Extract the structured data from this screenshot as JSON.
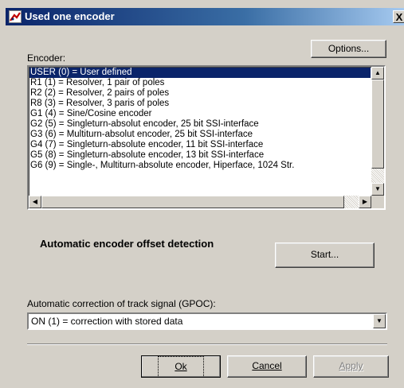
{
  "window": {
    "title": "Used one encoder",
    "close_label": "X"
  },
  "options_button": "Options...",
  "encoder": {
    "label": "Encoder:",
    "items": [
      "USER (0) = User defined",
      "R1 (1) = Resolver, 1 pair of poles",
      "R2 (2) = Resolver, 2 pairs of poles",
      "R8 (3) = Resolver, 3 paris of poles",
      "G1 (4) = Sine/Cosine encoder",
      "G2 (5) = Singleturn-absolut encoder, 25 bit SSI-interface",
      "G3 (6) = Multiturn-absolut encoder, 25 bit SSI-interface",
      "G4 (7) = Singleturn-absolute encoder, 11 bit SSI-interface",
      "G5 (8) = Singleturn-absolute encoder, 13 bit SSI-interface",
      "G6 (9) = Single-, Multiturn-absolute encoder, Hiperface, 1024 Str."
    ],
    "selected_index": 0
  },
  "offset": {
    "heading": "Automatic encoder offset detection",
    "start_button": "Start..."
  },
  "gpoc": {
    "label": "Automatic correction of track signal (GPOC):",
    "value": "ON (1) = correction with stored data"
  },
  "buttons": {
    "ok": "Ok",
    "cancel": "Cancel",
    "apply": "Apply"
  },
  "icons": {
    "window": "encoder-app-icon",
    "scroll_up": "triangle-up-icon",
    "scroll_down": "triangle-down-icon",
    "scroll_left": "triangle-left-icon",
    "scroll_right": "triangle-right-icon",
    "combo": "triangle-down-icon"
  }
}
